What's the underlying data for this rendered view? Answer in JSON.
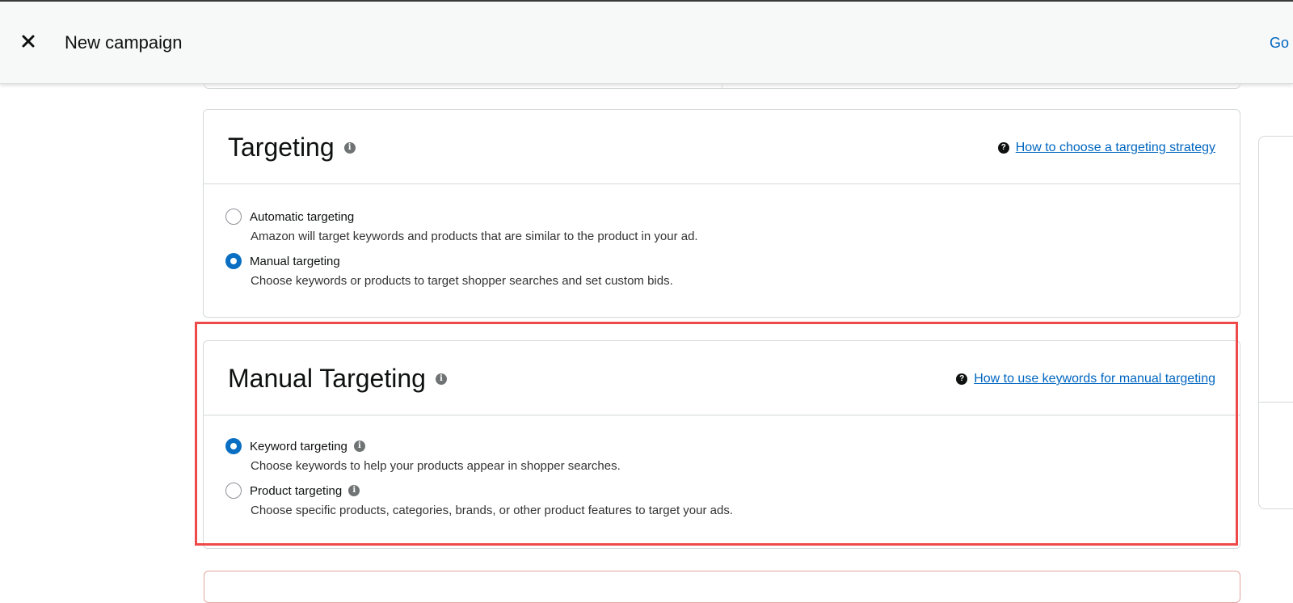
{
  "header": {
    "title": "New campaign",
    "go_label": "Go"
  },
  "targeting": {
    "title": "Targeting",
    "help_link": "How to choose a targeting strategy",
    "options": [
      {
        "label": "Automatic targeting",
        "description": "Amazon will target keywords and products that are similar to the product in your ad.",
        "selected": false
      },
      {
        "label": "Manual targeting",
        "description": "Choose keywords or products to target shopper searches and set custom bids.",
        "selected": true
      }
    ]
  },
  "manual_targeting": {
    "title": "Manual Targeting",
    "help_link": "How to use keywords for manual targeting",
    "options": [
      {
        "label": "Keyword targeting",
        "description": "Choose keywords to help your products appear in shopper searches.",
        "selected": true
      },
      {
        "label": "Product targeting",
        "description": "Choose specific products, categories, brands, or other product features to target your ads.",
        "selected": false
      }
    ]
  },
  "colors": {
    "accent": "#0a6fc2",
    "link": "#0066c0",
    "highlight_border": "#ef4a4a"
  },
  "icons": {
    "close": "close-icon",
    "info": "info-icon",
    "help": "help-icon"
  }
}
